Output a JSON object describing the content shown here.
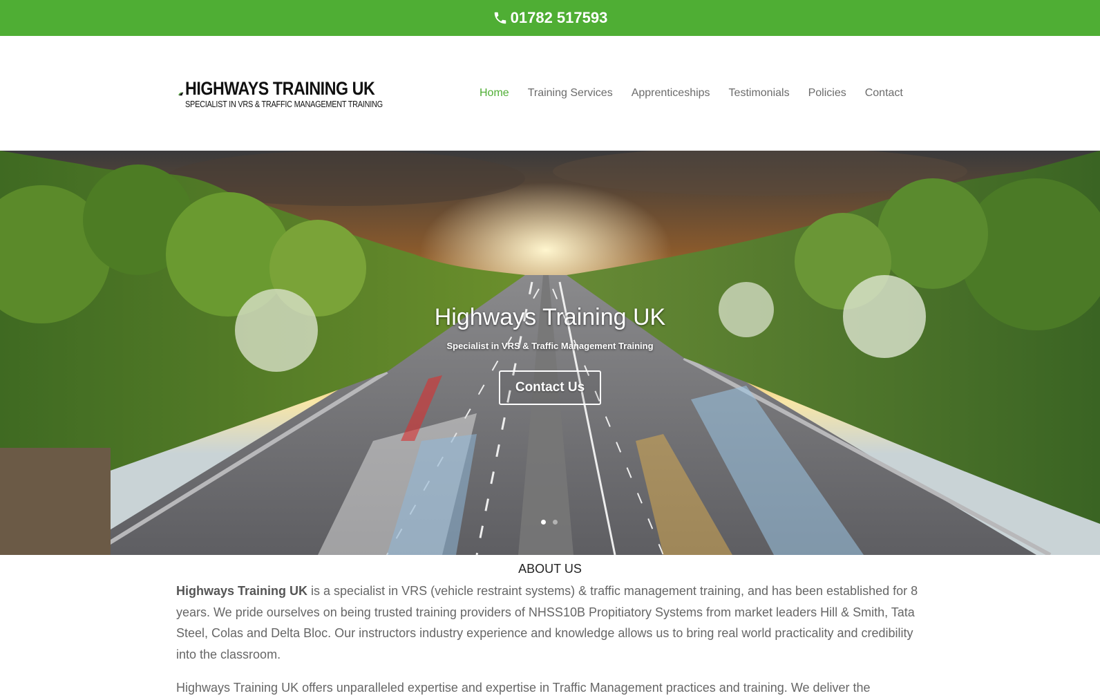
{
  "topbar": {
    "phone": "01782 517593",
    "bg_color": "#4fae34",
    "icon": "phone-icon"
  },
  "logo": {
    "title": "HIGHWAYS TRAINING UK",
    "subtitle": "SPECIALIST IN VRS & TRAFFIC MANAGEMENT TRAINING"
  },
  "nav": {
    "items": [
      {
        "label": "Home",
        "active": true
      },
      {
        "label": "Training Services"
      },
      {
        "label": "Apprenticeships"
      },
      {
        "label": "Testimonials"
      },
      {
        "label": "Policies"
      },
      {
        "label": "Contact"
      }
    ],
    "active_color": "#4fae34"
  },
  "hero": {
    "title": "Highways Training UK",
    "subtitle": "Specialist in VRS & Traffic Management Training",
    "button": "Contact Us",
    "slide_count": 2,
    "active_slide": 1
  },
  "about": {
    "heading": "ABOUT US",
    "p1_bold": "Highways Training UK",
    "p1_rest": " is a specialist in VRS (vehicle restraint systems) & traffic management training, and has been established for 8 years. We pride ourselves on being trusted training providers of NHSS10B Propitiatory Systems from market leaders Hill & Smith, Tata Steel, Colas and Delta Bloc. Our instructors industry experience and knowledge allows us to bring real world practicality and credibility into the classroom.",
    "p2": "Highways Training UK offers unparalleled expertise and expertise in Traffic Management practices and training. We deliver the"
  }
}
